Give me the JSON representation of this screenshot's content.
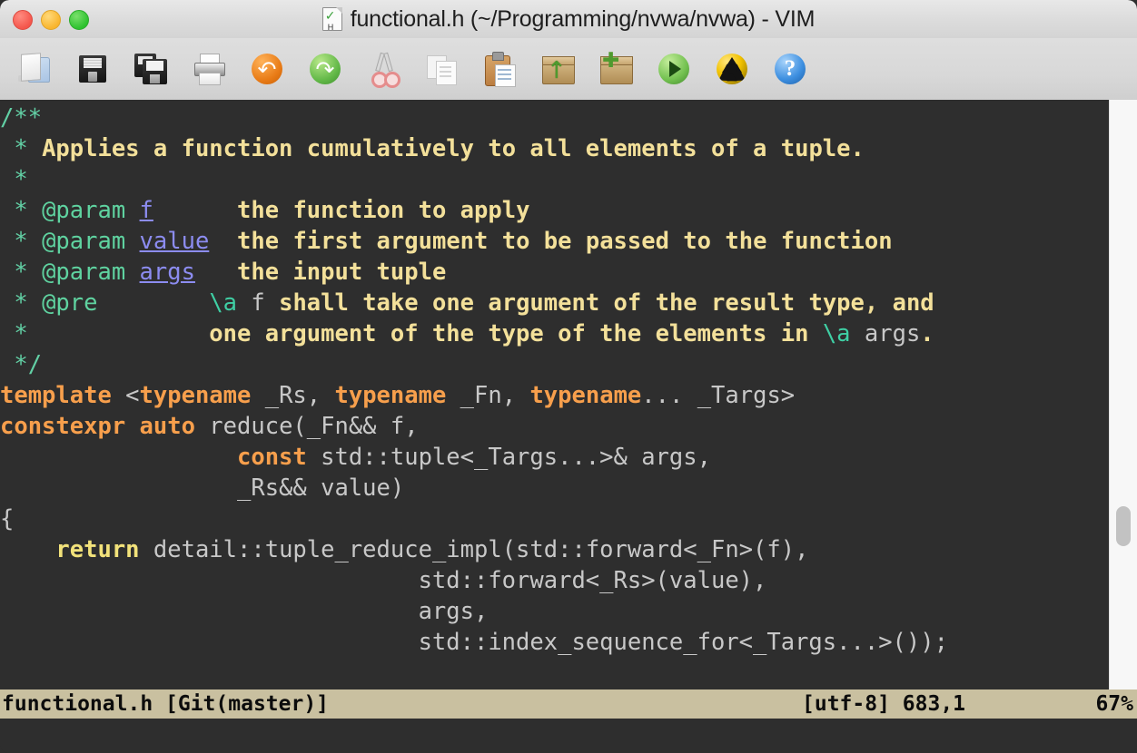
{
  "window": {
    "title": "functional.h (~/Programming/nvwa/nvwa) - VIM",
    "title_icon": "vim-header-file-icon",
    "traffic_lights": [
      {
        "name": "close-button",
        "color": "#f4564c"
      },
      {
        "name": "minimize-button",
        "color": "#f9b52e"
      },
      {
        "name": "zoom-button",
        "color": "#2ec22f"
      }
    ]
  },
  "toolbar": {
    "buttons": [
      {
        "icon": "open-folder-icon",
        "label": "Open"
      },
      {
        "icon": "save-floppy-icon",
        "label": "Save"
      },
      {
        "icon": "save-all-icon",
        "label": "Save All"
      },
      {
        "icon": "print-icon",
        "label": "Print"
      },
      {
        "icon": "undo-icon",
        "label": "Undo"
      },
      {
        "icon": "redo-icon",
        "label": "Redo"
      },
      {
        "icon": "cut-scissors-icon",
        "label": "Cut"
      },
      {
        "icon": "copy-icon",
        "label": "Copy"
      },
      {
        "icon": "paste-clipboard-icon",
        "label": "Paste"
      },
      {
        "icon": "load-session-box-icon",
        "label": "Load Session"
      },
      {
        "icon": "save-session-box-icon",
        "label": "Save Session"
      },
      {
        "icon": "run-script-play-icon",
        "label": "Run Script"
      },
      {
        "icon": "make-radiation-icon",
        "label": "Make"
      },
      {
        "icon": "help-question-icon",
        "label": "Help"
      }
    ]
  },
  "editor": {
    "lines": [
      [
        {
          "t": "/**",
          "c": "c-cdelim"
        }
      ],
      [
        {
          "t": " * ",
          "c": "c-cdelim"
        },
        {
          "t": "Applies a function cumulatively to all elements of a tuple.",
          "c": "c-comment"
        }
      ],
      [
        {
          "t": " *",
          "c": "c-cdelim"
        }
      ],
      [
        {
          "t": " * ",
          "c": "c-cdelim"
        },
        {
          "t": "@param",
          "c": "c-tag"
        },
        {
          "t": " ",
          "c": "c-cdelim"
        },
        {
          "t": "f",
          "c": "c-param"
        },
        {
          "t": "      ",
          "c": "c-plain"
        },
        {
          "t": "the function to apply",
          "c": "c-comment"
        }
      ],
      [
        {
          "t": " * ",
          "c": "c-cdelim"
        },
        {
          "t": "@param",
          "c": "c-tag"
        },
        {
          "t": " ",
          "c": "c-cdelim"
        },
        {
          "t": "value",
          "c": "c-param"
        },
        {
          "t": "  ",
          "c": "c-plain"
        },
        {
          "t": "the first argument to be passed to the function",
          "c": "c-comment"
        }
      ],
      [
        {
          "t": " * ",
          "c": "c-cdelim"
        },
        {
          "t": "@param",
          "c": "c-tag"
        },
        {
          "t": " ",
          "c": "c-cdelim"
        },
        {
          "t": "args",
          "c": "c-param"
        },
        {
          "t": "   ",
          "c": "c-plain"
        },
        {
          "t": "the input tuple",
          "c": "c-comment"
        }
      ],
      [
        {
          "t": " * ",
          "c": "c-cdelim"
        },
        {
          "t": "@pre",
          "c": "c-tag"
        },
        {
          "t": "        ",
          "c": "c-plain"
        },
        {
          "t": "\\a",
          "c": "c-special"
        },
        {
          "t": " f ",
          "c": "c-ident"
        },
        {
          "t": "shall take one argument of the result type, and",
          "c": "c-comment"
        }
      ],
      [
        {
          "t": " * ",
          "c": "c-cdelim"
        },
        {
          "t": "            ",
          "c": "c-plain"
        },
        {
          "t": "one argument of the type of the elements in ",
          "c": "c-comment"
        },
        {
          "t": "\\a",
          "c": "c-special"
        },
        {
          "t": " args",
          "c": "c-ident"
        },
        {
          "t": ".",
          "c": "c-comment"
        }
      ],
      [
        {
          "t": " */",
          "c": "c-cdelim"
        }
      ],
      [
        {
          "t": "template",
          "c": "c-kw"
        },
        {
          "t": " <",
          "c": "c-ident"
        },
        {
          "t": "typename",
          "c": "c-kw"
        },
        {
          "t": " _Rs, ",
          "c": "c-ident"
        },
        {
          "t": "typename",
          "c": "c-kw"
        },
        {
          "t": " _Fn, ",
          "c": "c-ident"
        },
        {
          "t": "typename",
          "c": "c-kw"
        },
        {
          "t": "... _Targs>",
          "c": "c-ident"
        }
      ],
      [
        {
          "t": "constexpr",
          "c": "c-kw"
        },
        {
          "t": " ",
          "c": "c-ident"
        },
        {
          "t": "auto",
          "c": "c-kw"
        },
        {
          "t": " reduce(_Fn&& f,",
          "c": "c-ident"
        }
      ],
      [
        {
          "t": "                 ",
          "c": "c-ident"
        },
        {
          "t": "const",
          "c": "c-kw"
        },
        {
          "t": " std::tuple<_Targs...>& args,",
          "c": "c-ident"
        }
      ],
      [
        {
          "t": "                 _Rs&& value)",
          "c": "c-ident"
        }
      ],
      [
        {
          "t": "{",
          "c": "c-ident"
        }
      ],
      [
        {
          "t": "    ",
          "c": "c-ident"
        },
        {
          "t": "return",
          "c": "c-stmt"
        },
        {
          "t": " detail::tuple_reduce_impl(std::forward<_Fn>(f),",
          "c": "c-ident"
        }
      ],
      [
        {
          "t": "                              std::forward<_Rs>(value),",
          "c": "c-ident"
        }
      ],
      [
        {
          "t": "                              args,",
          "c": "c-ident"
        }
      ],
      [
        {
          "t": "                              std::index_sequence_for<_Targs...>());",
          "c": "c-ident"
        }
      ],
      [
        {
          "t": "",
          "c": "c-ident"
        }
      ],
      [
        {
          "t": "}",
          "c": "c-ident"
        }
      ]
    ],
    "cursor": {
      "line": 19,
      "column": 1
    }
  },
  "scrollbar": {
    "name": "vertical-scrollbar",
    "thumb_position_pct": 67
  },
  "statusbar": {
    "file": "functional.h [Git(master)]",
    "encoding": "[utf-8] 683,1",
    "percent": "67%"
  },
  "colors": {
    "editor_bg": "#2e2e2e",
    "statusbar_bg": "#c9c0a0",
    "comment": "#f3e09a",
    "keyword": "#f79f4c",
    "identifier": "#c8c8c8",
    "doc_tag": "#5fd3a0",
    "doc_param": "#8c8cf0",
    "cursor": "#e8e23f"
  }
}
